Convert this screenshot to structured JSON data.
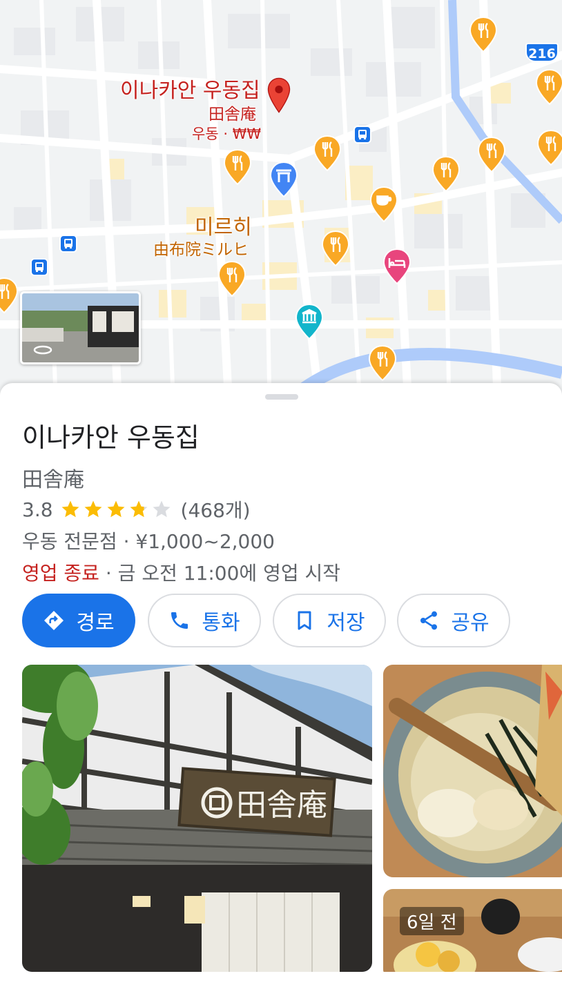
{
  "map": {
    "selected_place": {
      "name": "이나카안 우동집",
      "native_name": "田舎庵",
      "meta": "우동 · ₩₩"
    },
    "nearby_place": {
      "name": "미르히",
      "native_name": "由布院ミルヒ"
    },
    "route_number": "216"
  },
  "place": {
    "title": "이나카안 우동집",
    "subtitle": "田舎庵",
    "rating": "3.8",
    "rating_value": 3.8,
    "review_count": "(468개)",
    "category_price": "우동 전문점 · ¥1,000~2,000",
    "status_closed": "영업 종료",
    "status_next": " · 금 오전 11:00에 영업 시작"
  },
  "actions": {
    "directions": "경로",
    "call": "통화",
    "save": "저장",
    "share": "공유"
  },
  "photos": {
    "recent_badge": "6일 전"
  },
  "colors": {
    "accent": "#1a73e8",
    "closed": "#c5221f",
    "food_pin": "#f9a825",
    "star": "#fbbc04"
  }
}
